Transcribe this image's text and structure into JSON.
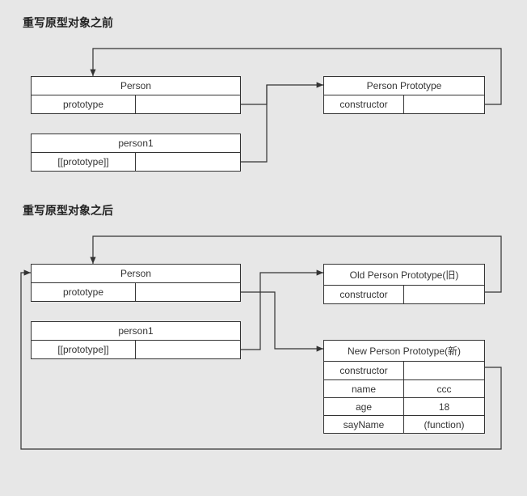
{
  "before": {
    "title": "重写原型对象之前",
    "person": {
      "header": "Person",
      "row1": "prototype"
    },
    "person1": {
      "header": "person1",
      "row1": "[[prototype]]"
    },
    "proto": {
      "header": "Person Prototype",
      "row1": "constructor"
    }
  },
  "after": {
    "title": "重写原型对象之后",
    "person": {
      "header": "Person",
      "row1": "prototype"
    },
    "person1": {
      "header": "person1",
      "row1": "[[prototype]]"
    },
    "oldProto": {
      "header": "Old Person Prototype(旧)",
      "row1": "constructor"
    },
    "newProto": {
      "header": "New Person Prototype(新)",
      "rows": [
        {
          "k": "constructor",
          "v": ""
        },
        {
          "k": "name",
          "v": "ccc"
        },
        {
          "k": "age",
          "v": "18"
        },
        {
          "k": "sayName",
          "v": "(function)"
        }
      ]
    }
  }
}
